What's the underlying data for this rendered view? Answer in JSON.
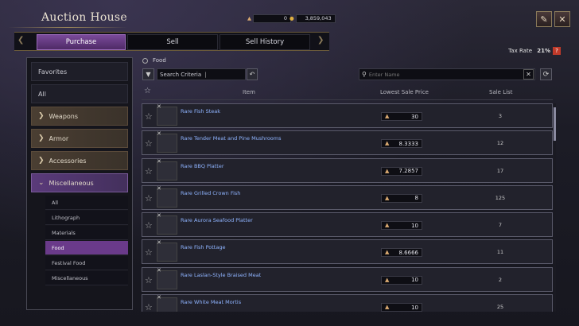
{
  "window": {
    "title": "Auction House"
  },
  "currency": {
    "silver": "0",
    "gold": "3,859,043"
  },
  "tabs": [
    "Purchase",
    "Sell",
    "Sell History"
  ],
  "tax": {
    "label": "Tax Rate",
    "value": "21%"
  },
  "sidebar": {
    "favorites": "Favorites",
    "all": "All",
    "categories": [
      "Weapons",
      "Armor",
      "Accessories",
      "Miscellaneous"
    ],
    "sub_items": [
      "All",
      "Lithograph",
      "Materials",
      "Food",
      "Festival Food",
      "Miscellaneous"
    ]
  },
  "breadcrumb": "Food",
  "search": {
    "criteria": "Search Criteria",
    "name_placeholder": "Enter Name"
  },
  "table": {
    "headers": {
      "item": "Item",
      "price": "Lowest Sale Price",
      "sale": "Sale List"
    },
    "rows": [
      {
        "name": "Rare Fish Steak",
        "price": "30",
        "sale": "3"
      },
      {
        "name": "Rare Tender Meat and Pine Mushrooms",
        "price": "8.3333",
        "sale": "12"
      },
      {
        "name": "Rare BBQ Platter",
        "price": "7.2857",
        "sale": "17"
      },
      {
        "name": "Rare Grilled Crown Fish",
        "price": "8",
        "sale": "125"
      },
      {
        "name": "Rare Aurora Seafood Platter",
        "price": "10",
        "sale": "7"
      },
      {
        "name": "Rare Fish Pottage",
        "price": "8.6666",
        "sale": "11"
      },
      {
        "name": "Rare Laslan-Style Braised Meat",
        "price": "10",
        "sale": "2"
      },
      {
        "name": "Rare White Meat Mortis",
        "price": "10",
        "sale": "25"
      }
    ]
  }
}
